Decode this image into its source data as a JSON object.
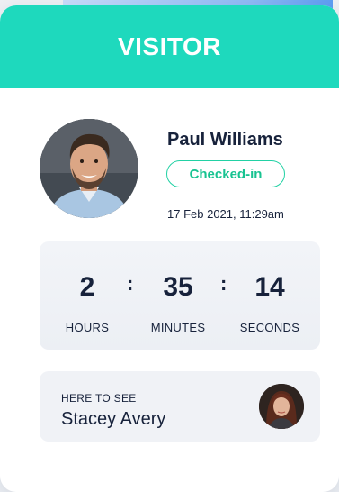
{
  "header": {
    "title": "VISITOR"
  },
  "visitor": {
    "name": "Paul Williams",
    "status": "Checked-in",
    "checked_in_at": "17 Feb 2021, 11:29am"
  },
  "timer": {
    "hours": {
      "value": "2",
      "label": "HOURS"
    },
    "minutes": {
      "value": "35",
      "label": "MINUTES"
    },
    "seconds": {
      "value": "14",
      "label": "SECONDS"
    },
    "separator": ":"
  },
  "host": {
    "label": "HERE TO SEE",
    "name": "Stacey Avery"
  },
  "colors": {
    "header": "#1ed9bd",
    "badge": "#22d1a4",
    "text": "#17223b"
  }
}
